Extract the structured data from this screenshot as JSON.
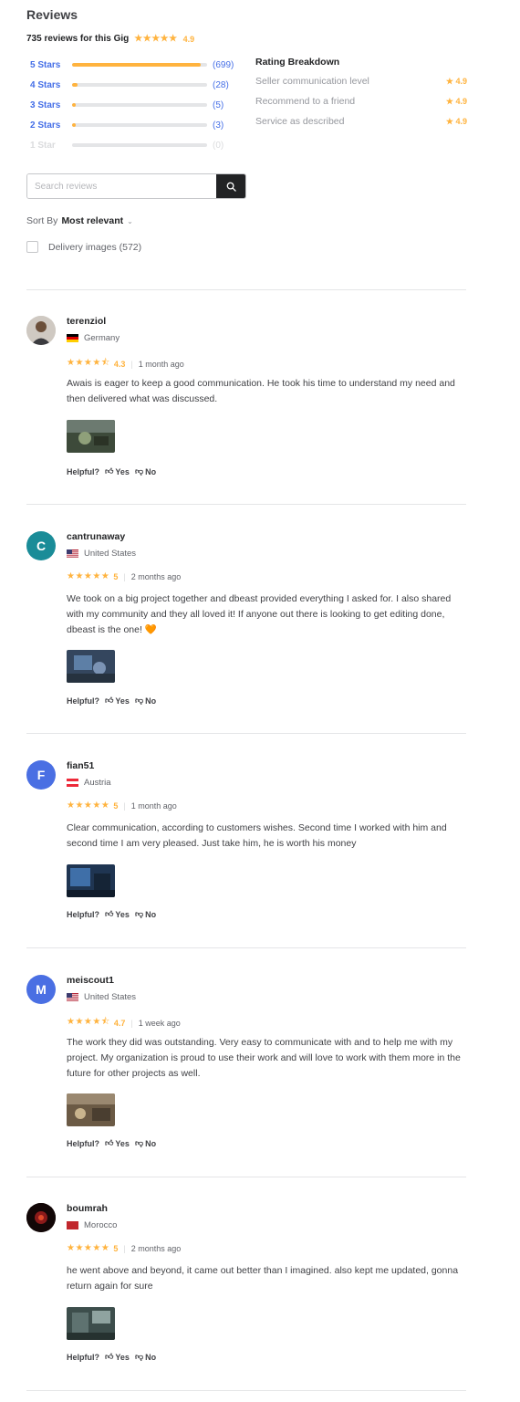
{
  "header": {
    "title": "Reviews",
    "summary_text": "735 reviews for this Gig",
    "summary_stars": "★★★★★",
    "summary_score": "4.9"
  },
  "breakdown": [
    {
      "label": "5 Stars",
      "count": "(699)",
      "fraction": 0.95
    },
    {
      "label": "4 Stars",
      "count": "(28)",
      "fraction": 0.04
    },
    {
      "label": "3 Stars",
      "count": "(5)",
      "fraction": 0.01
    },
    {
      "label": "2 Stars",
      "count": "(3)",
      "fraction": 0.005
    },
    {
      "label": "1 Star",
      "count": "(0)",
      "fraction": 0
    }
  ],
  "rating_breakdown": {
    "title": "Rating Breakdown",
    "rows": [
      {
        "label": "Seller communication level",
        "value": "★ 4.9"
      },
      {
        "label": "Recommend to a friend",
        "value": "★ 4.9"
      },
      {
        "label": "Service as described",
        "value": "★ 4.9"
      }
    ]
  },
  "search": {
    "placeholder": "Search reviews"
  },
  "sort": {
    "label": "Sort By",
    "value": "Most relevant",
    "chevron": "⌄"
  },
  "filter": {
    "label": "Delivery images (572)"
  },
  "helpful_label": "Helpful?",
  "yes_label": "Yes",
  "no_label": "No",
  "reviews": [
    {
      "username": "terenziol",
      "country": "Germany",
      "stars": "★★★★⯪",
      "score": "4.3",
      "when": "1 month ago",
      "text": "Awais is eager to keep a good communication. He took his time to understand my need and then delivered what was discussed.",
      "avatar_letter": "",
      "avatar_color": "#7a6f64"
    },
    {
      "username": "cantrunaway",
      "country": "United States",
      "stars": "★★★★★",
      "score": "5",
      "when": "2 months ago",
      "text": "We took on a big project together and dbeast provided everything I asked for. I also shared with my community and they all loved it! If anyone out there is looking to get editing done, dbeast is the one! 🧡",
      "avatar_letter": "C",
      "avatar_color": "#1a8c98"
    },
    {
      "username": "fian51",
      "country": "Austria",
      "stars": "★★★★★",
      "score": "5",
      "when": "1 month ago",
      "text": "Clear communication, according to customers wishes. Second time I worked with him and second time I am very pleased. Just take him, he is worth his money",
      "avatar_letter": "F",
      "avatar_color": "#4a6fe3"
    },
    {
      "username": "meiscout1",
      "country": "United States",
      "stars": "★★★★⯪",
      "score": "4.7",
      "when": "1 week ago",
      "text": "The work they did was outstanding. Very easy to communicate with and to help me with my project. My organization is proud to use their work and will love to work with them more in the future for other projects as well.",
      "avatar_letter": "M",
      "avatar_color": "#4a6fe3"
    },
    {
      "username": "boumrah",
      "country": "Morocco",
      "stars": "★★★★★",
      "score": "5",
      "when": "2 months ago",
      "text": "he went above and beyond, it came out better than I imagined. also kept me updated, gonna return again for sure",
      "avatar_letter": "",
      "avatar_color": "#1a0d0d"
    }
  ]
}
